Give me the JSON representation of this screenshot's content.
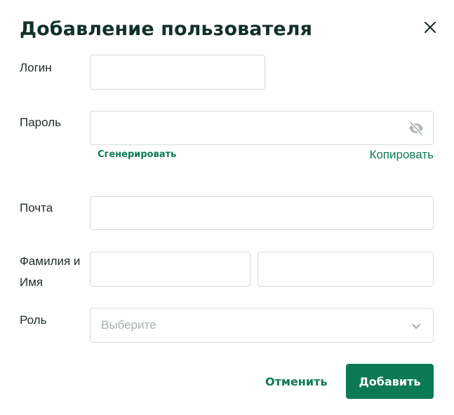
{
  "dialog": {
    "title": "Добавление пользователя",
    "close_icon": "close-icon"
  },
  "fields": {
    "login": {
      "label": "Логин",
      "value": "",
      "placeholder": ""
    },
    "password": {
      "label": "Пароль",
      "value": "",
      "placeholder": "",
      "toggle_icon": "eye-off-icon",
      "generate_label": "Сгенерировать",
      "copy_label": "Копировать"
    },
    "email": {
      "label": "Почта",
      "value": "",
      "placeholder": ""
    },
    "name": {
      "label": "Фамилия и Имя",
      "last_name_value": "",
      "first_name_value": ""
    },
    "role": {
      "label": "Роль",
      "placeholder": "Выберите",
      "icon": "chevron-down-icon"
    }
  },
  "actions": {
    "cancel_label": "Отменить",
    "submit_label": "Добавить"
  },
  "colors": {
    "accent": "#0b7a55",
    "title": "#12302a",
    "border": "#d8dcdc",
    "placeholder": "#a9b0b0"
  }
}
